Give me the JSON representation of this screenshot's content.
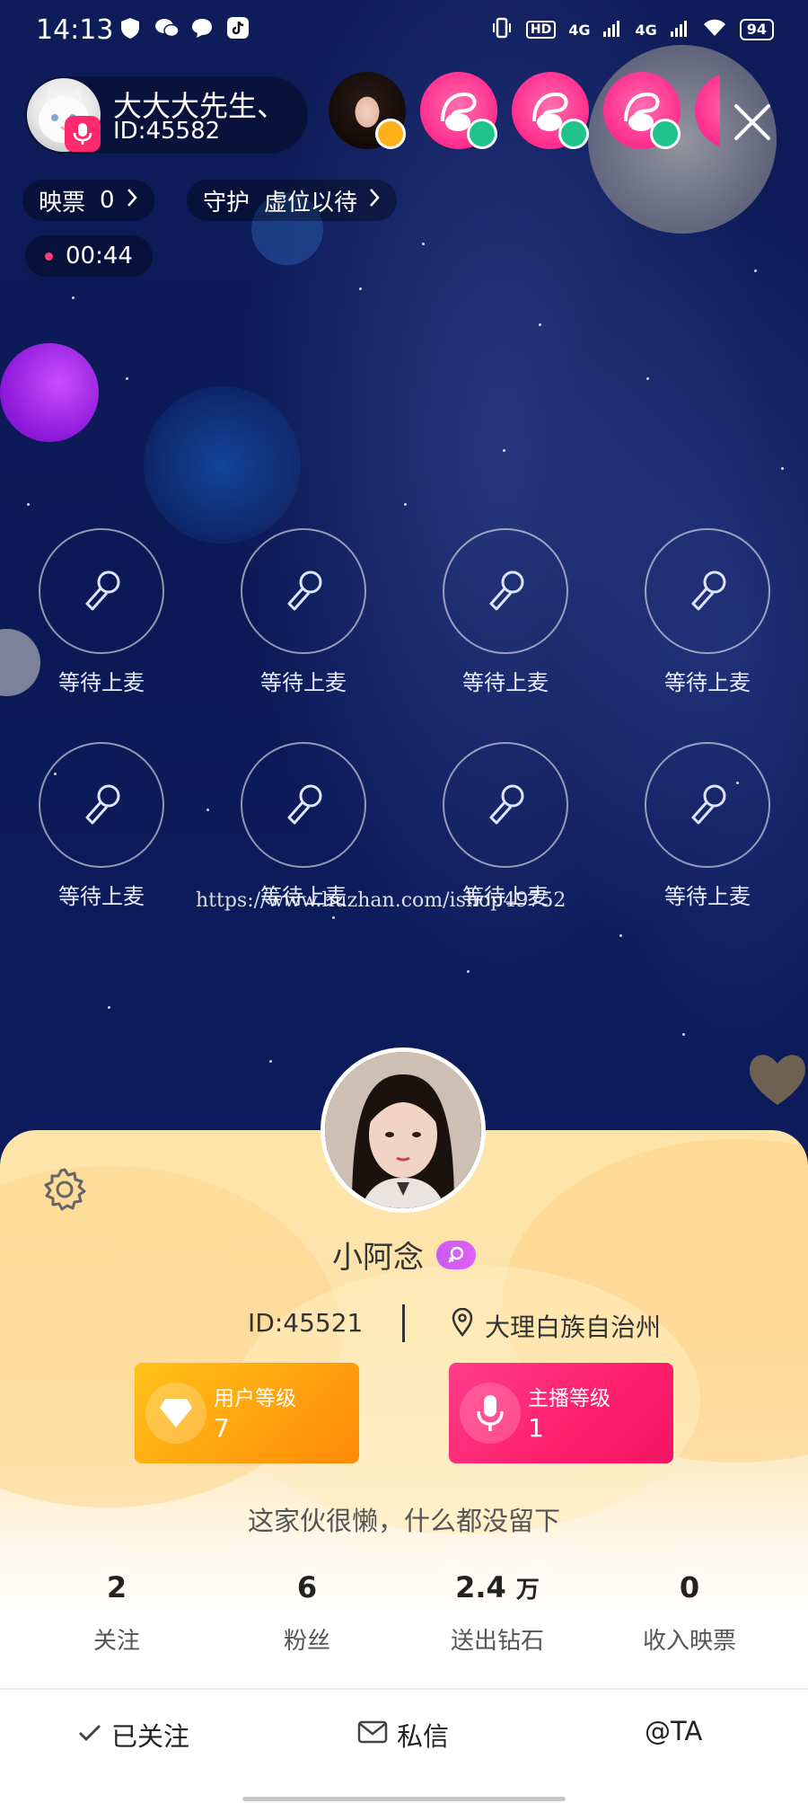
{
  "status_bar": {
    "time": "14:13",
    "hd_label": "HD",
    "net_label_1": "4G",
    "net_label_2": "4G",
    "battery": "94"
  },
  "host": {
    "name": "大大大先生、",
    "id_text": "ID:45582"
  },
  "top_pills": {
    "ticket_label": "映票",
    "ticket_value": "0",
    "guard_label": "守护",
    "guard_value": "虚位以待"
  },
  "timer": "00:44",
  "seats": [
    {
      "label": "等待上麦"
    },
    {
      "label": "等待上麦"
    },
    {
      "label": "等待上麦"
    },
    {
      "label": "等待上麦"
    },
    {
      "label": "等待上麦"
    },
    {
      "label": "等待上麦"
    },
    {
      "label": "等待上麦"
    },
    {
      "label": "等待上麦"
    }
  ],
  "watermark": "https://www.huzhan.com/ishop49752",
  "profile": {
    "name": "小阿念",
    "id_text": "ID:45521",
    "location": "大理白族自治州",
    "user_level_label": "用户等级",
    "user_level_value": "7",
    "host_level_label": "主播等级",
    "host_level_value": "1",
    "bio": "这家伙很懒，什么都没留下",
    "stats": [
      {
        "value": "2",
        "unit": "",
        "label": "关注"
      },
      {
        "value": "6",
        "unit": "",
        "label": "粉丝"
      },
      {
        "value": "2.4",
        "unit": "万",
        "label": "送出钻石"
      },
      {
        "value": "0",
        "unit": "",
        "label": "收入映票"
      }
    ],
    "actions": {
      "follow": "已关注",
      "message": "私信",
      "mention": "@TA"
    }
  },
  "colors": {
    "room_bg": "#0d1a52",
    "accent_pink": "#ff2a6d",
    "user_level": "#ffa30e",
    "host_level": "#ff1f6c"
  }
}
